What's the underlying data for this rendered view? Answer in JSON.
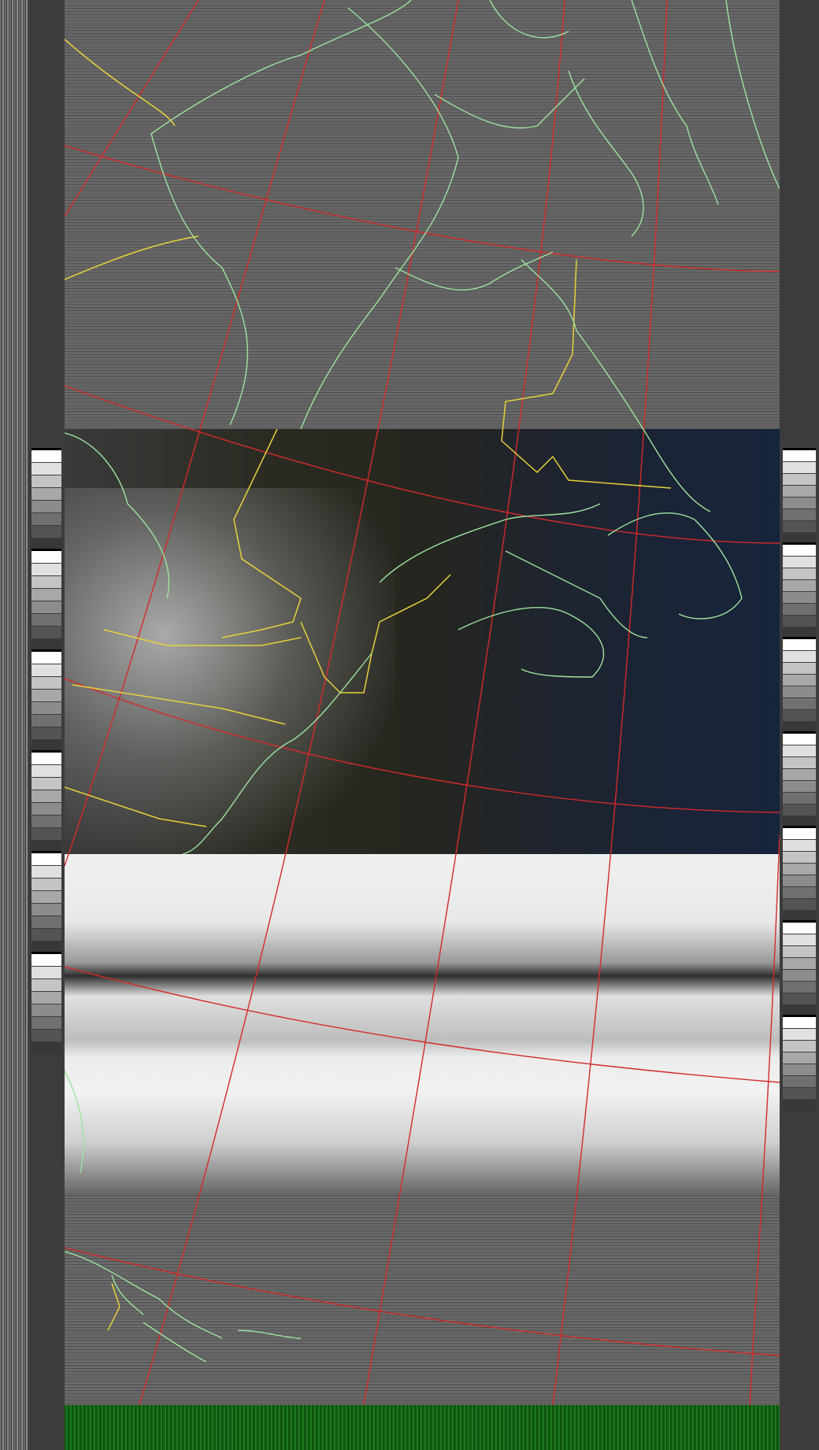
{
  "image": {
    "kind": "NOAA APT satellite image",
    "overlays": [
      "lat-lon-grid",
      "coastlines",
      "state-borders"
    ],
    "colors": {
      "grid": "#d42a2a",
      "coastline": "#9ee29e",
      "border": "#e6d23a",
      "sync-bar": "#1a7a1e",
      "ocean": "#16243c"
    },
    "icons": [
      "calibration-wedge"
    ]
  }
}
